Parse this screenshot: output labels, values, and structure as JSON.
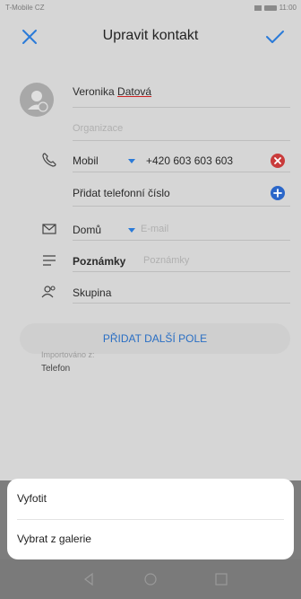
{
  "status_bar": {
    "carrier": "T-Mobile CZ",
    "time": "11:00"
  },
  "header": {
    "title": "Upravit kontakt"
  },
  "contact": {
    "name_prefix": "Veronika ",
    "name_surname": "Datová",
    "organization_placeholder": "Organizace"
  },
  "phone": {
    "label": "Mobil",
    "number": "+420 603 603 603",
    "add_label": "Přidat telefonní číslo"
  },
  "email": {
    "label": "Domů",
    "placeholder": "E-mail"
  },
  "notes": {
    "label": "Poznámky",
    "placeholder": "Poznámky"
  },
  "group": {
    "label": "Skupina"
  },
  "add_field_button": "PŘIDAT DALŠÍ POLE",
  "imported": {
    "label": "Importováno z:",
    "value": "Telefon"
  },
  "sheet": {
    "items": [
      "Vyfotit",
      "Vybrat z galerie"
    ]
  },
  "colors": {
    "accent": "#2a7ad8",
    "remove": "#c93b3b",
    "add": "#2b67c9",
    "overlay": "#7d7d7d"
  },
  "icons": [
    "close-icon",
    "check-icon",
    "phone-icon",
    "mail-icon",
    "notes-icon",
    "group-icon",
    "back-icon",
    "home-icon",
    "recents-icon"
  ]
}
